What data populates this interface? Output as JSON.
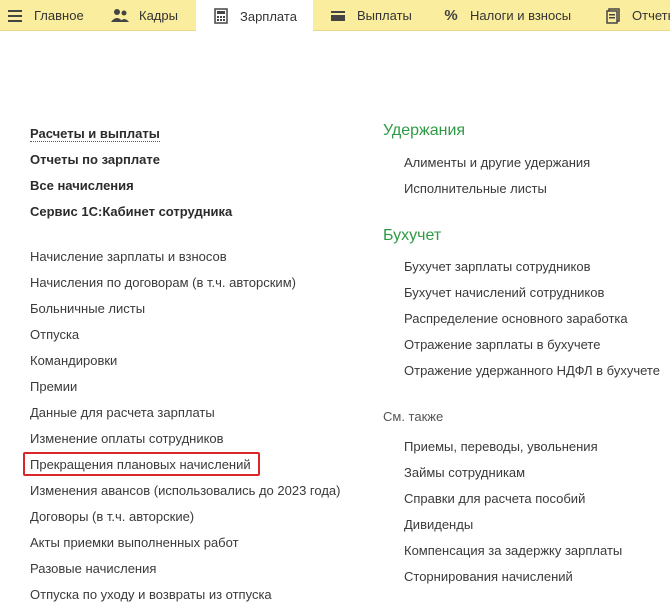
{
  "nav": {
    "tabs": [
      {
        "label": "Главное",
        "icon": "menu-icon",
        "active": false
      },
      {
        "label": "Кадры",
        "icon": "people-icon",
        "active": false
      },
      {
        "label": "Зарплата",
        "icon": "calculator-icon",
        "active": true
      },
      {
        "label": "Выплаты",
        "icon": "wallet-icon",
        "active": false
      },
      {
        "label": "Налоги и взносы",
        "icon": "percent-icon",
        "active": false
      },
      {
        "label": "Отчетн",
        "icon": "report-icon",
        "active": false
      }
    ]
  },
  "left": {
    "bold_links": [
      "Расчеты и выплаты",
      "Отчеты по зарплате",
      "Все начисления",
      "Сервис 1С:Кабинет сотрудника"
    ],
    "links": [
      "Начисление зарплаты и взносов",
      "Начисления по договорам (в т.ч. авторским)",
      "Больничные листы",
      "Отпуска",
      "Командировки",
      "Премии",
      "Данные для расчета зарплаты",
      "Изменение оплаты сотрудников",
      "Прекращения плановых начислений",
      "Изменения авансов (использовались до 2023 года)",
      "Договоры (в т.ч. авторские)",
      "Акты приемки выполненных работ",
      "Разовые начисления",
      "Отпуска по уходу и возвраты из отпуска"
    ]
  },
  "right": {
    "deductions": {
      "title": "Удержания",
      "items": [
        "Алименты и другие удержания",
        "Исполнительные листы"
      ]
    },
    "accounting": {
      "title": "Бухучет",
      "items": [
        "Бухучет зарплаты сотрудников",
        "Бухучет начислений сотрудников",
        "Распределение основного заработка",
        "Отражение зарплаты в бухучете",
        "Отражение удержанного НДФЛ в бухучете"
      ]
    },
    "see_also": {
      "title": "См. также",
      "items": [
        "Приемы, переводы, увольнения",
        "Займы сотрудникам",
        "Справки для расчета пособий",
        "Дивиденды",
        "Компенсация за задержку зарплаты",
        "Сторнирования начислений"
      ]
    }
  },
  "colors": {
    "topbar": "#fbed9e",
    "section_title": "#2f9a44",
    "highlight_border": "#d9262b"
  }
}
